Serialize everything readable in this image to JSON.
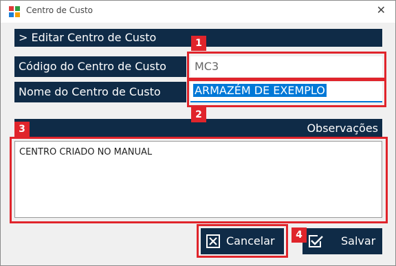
{
  "window": {
    "title": "Centro de Custo",
    "icon": "app-grid-icon",
    "close_icon": "close-icon"
  },
  "header": {
    "label": "> Editar Centro de Custo"
  },
  "fields": {
    "codigo": {
      "label": "Código do Centro de Custo",
      "value": "MC3"
    },
    "nome": {
      "label": "Nome do Centro de Custo",
      "value": "ARMAZÉM DE EXEMPLO"
    }
  },
  "observacoes": {
    "label": "Observações",
    "value": "CENTRO CRIADO NO MANUAL"
  },
  "buttons": {
    "cancelar": {
      "label": "Cancelar",
      "icon": "close-box-icon"
    },
    "salvar": {
      "label": "Salvar",
      "icon": "check-box-icon"
    }
  },
  "annotations": [
    "1",
    "2",
    "3",
    "4"
  ],
  "colors": {
    "accent": "#0f2b47",
    "annotation": "#e0242b",
    "selection": "#0078d7"
  }
}
